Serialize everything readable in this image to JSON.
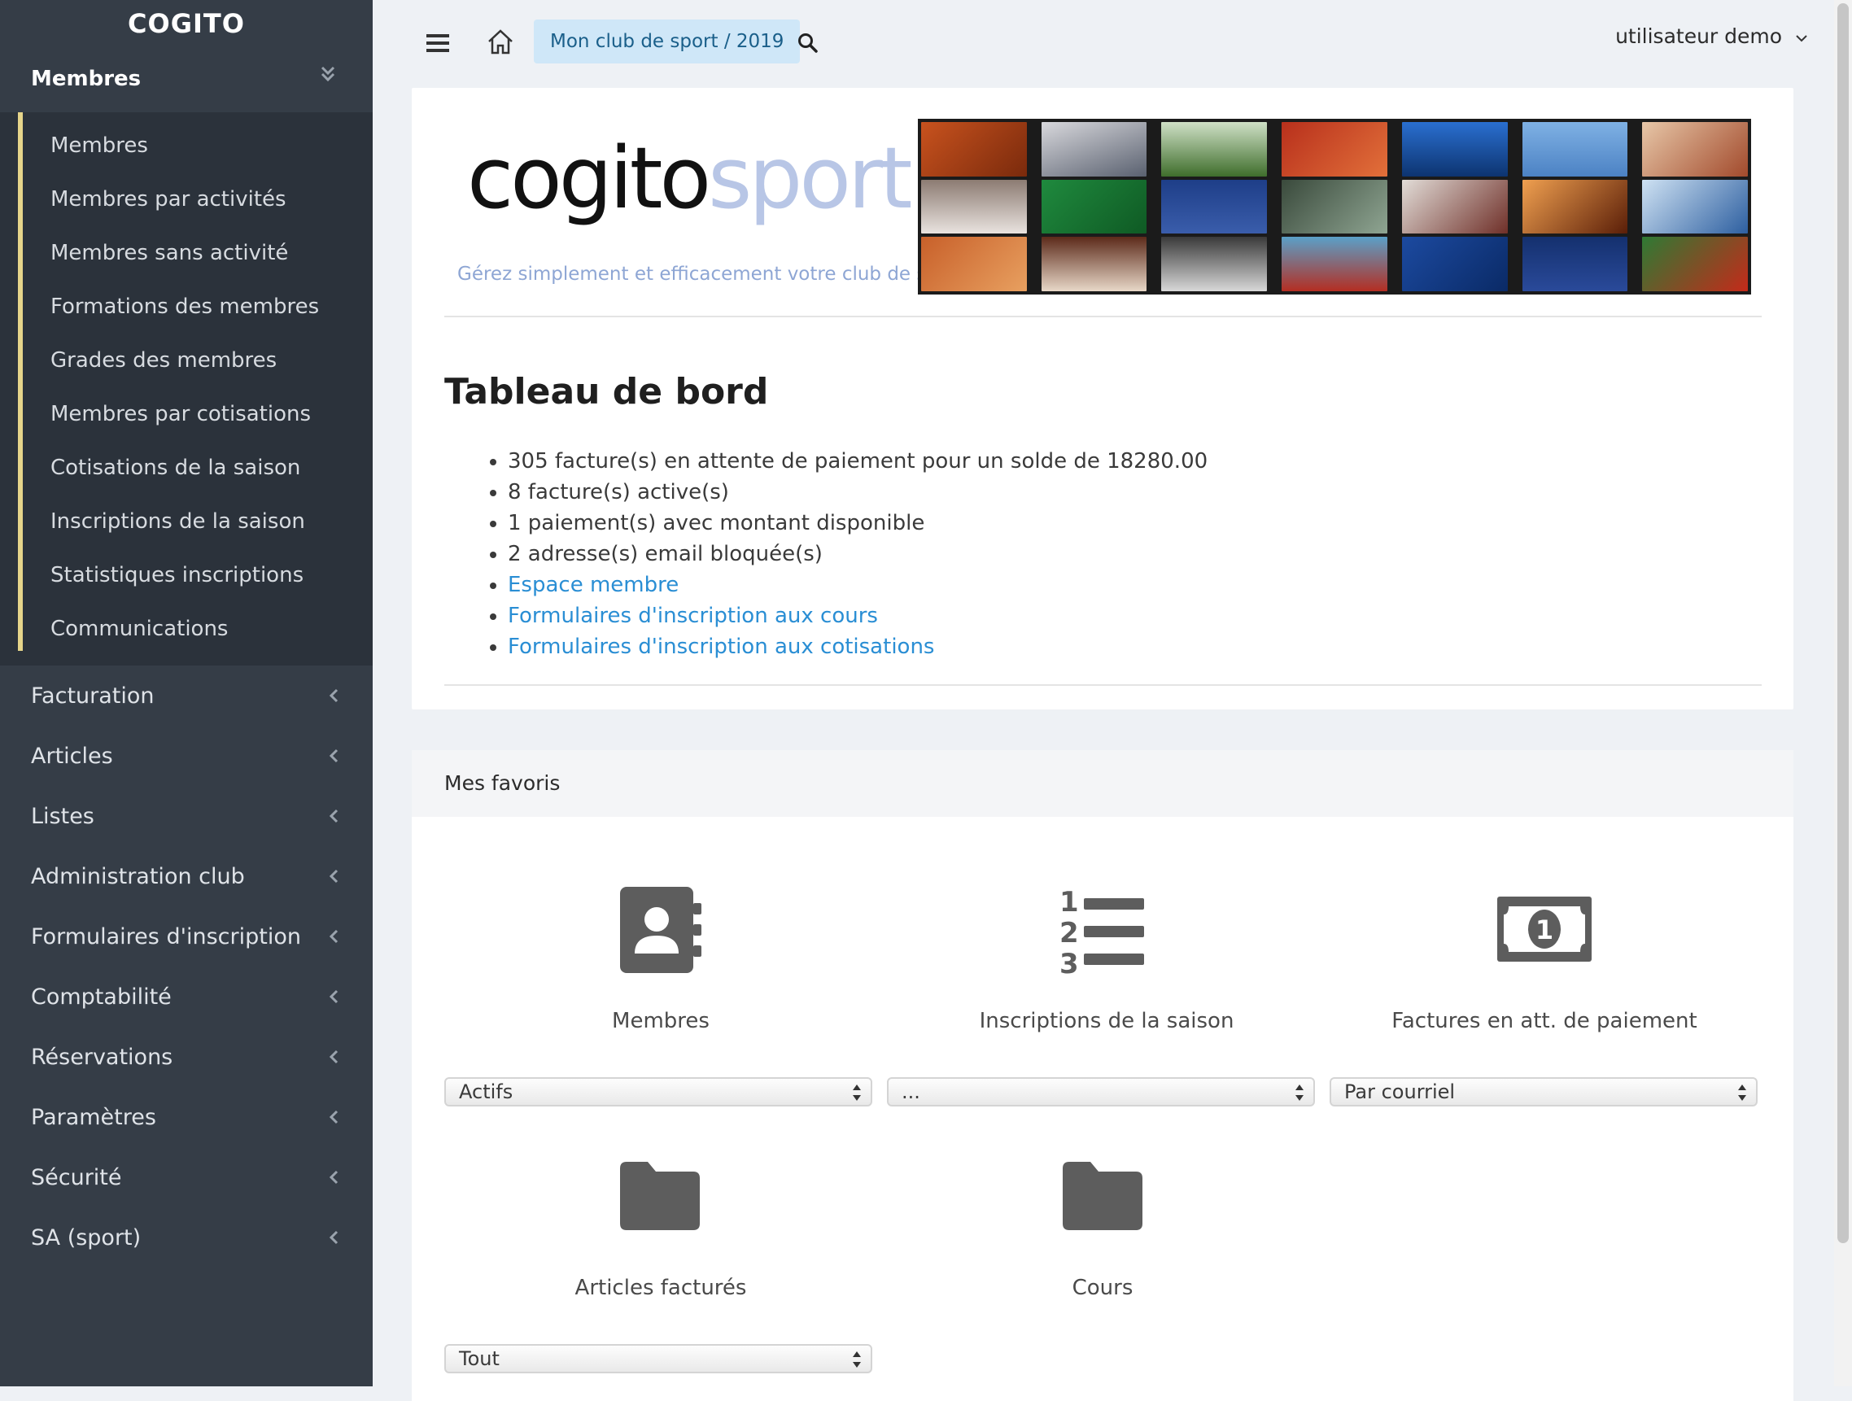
{
  "sidebar": {
    "brand": "COGITO",
    "section": "Membres",
    "sub_items": [
      {
        "label": "Membres"
      },
      {
        "label": "Membres par activités"
      },
      {
        "label": "Membres sans activité"
      },
      {
        "label": "Formations des membres"
      },
      {
        "label": "Grades des membres"
      },
      {
        "label": "Membres par cotisations"
      },
      {
        "label": "Cotisations de la saison"
      },
      {
        "label": "Inscriptions de la saison"
      },
      {
        "label": "Statistiques inscriptions"
      },
      {
        "label": "Communications"
      }
    ],
    "nav_items": [
      {
        "label": "Facturation"
      },
      {
        "label": "Articles"
      },
      {
        "label": "Listes"
      },
      {
        "label": "Administration club"
      },
      {
        "label": "Formulaires d'inscription"
      },
      {
        "label": "Comptabilité"
      },
      {
        "label": "Réservations"
      },
      {
        "label": "Paramètres"
      },
      {
        "label": "Sécurité"
      },
      {
        "label": "SA (sport)"
      }
    ]
  },
  "topbar": {
    "club_label": "Mon club de sport / 2019",
    "user_label": "utilisateur demo"
  },
  "logo": {
    "word1": "cogito",
    "word2": "sport",
    "tagline": "Gérez simplement et efficacement votre club de sport"
  },
  "dashboard": {
    "title": "Tableau de bord",
    "stats": [
      "305 facture(s) en attente de paiement pour un solde de 18280.00",
      "8 facture(s) active(s)",
      "1 paiement(s) avec montant disponible",
      "2 adresse(s) email bloquée(s)"
    ],
    "links": [
      "Espace membre",
      "Formulaires d'inscription aux cours",
      "Formulaires d'inscription aux cotisations"
    ]
  },
  "favorites": {
    "title": "Mes favoris",
    "items": [
      {
        "label": "Membres",
        "icon": "contact-book-icon",
        "select": "Actifs"
      },
      {
        "label": "Inscriptions de la saison",
        "icon": "ordered-list-icon",
        "select": "..."
      },
      {
        "label": "Factures en att. de paiement",
        "icon": "money-bill-icon",
        "select": "Par courriel"
      },
      {
        "label": "Articles facturés",
        "icon": "folder-icon",
        "select": "Tout"
      },
      {
        "label": "Cours",
        "icon": "folder-icon"
      }
    ]
  },
  "colors": {
    "sidebar_bg": "#353d47",
    "submenu_bg": "#2b323b",
    "submenu_accent": "#e6d58a",
    "link": "#2a8ed4",
    "club_badge_bg": "#cfe7f8"
  }
}
